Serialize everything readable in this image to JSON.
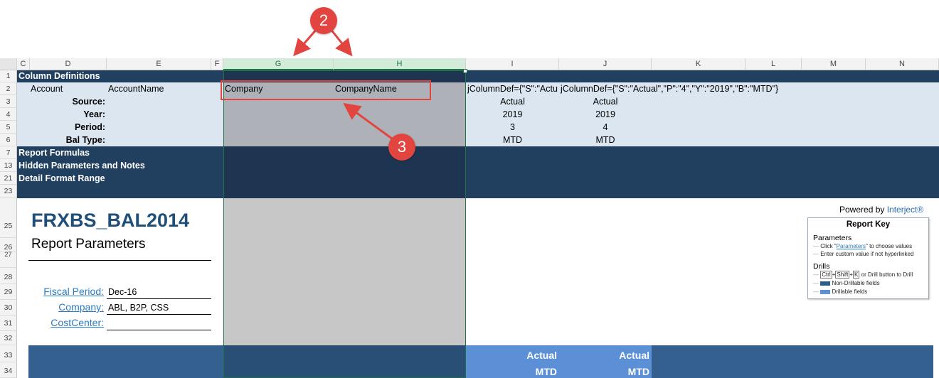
{
  "columns": [
    "C",
    "D",
    "E",
    "F",
    "G",
    "H",
    "I",
    "J",
    "K",
    "L",
    "M",
    "N"
  ],
  "rows": [
    "1",
    "2",
    "3",
    "4",
    "5",
    "6",
    "7",
    "13",
    "21",
    "23",
    "25",
    "26",
    "27",
    "28",
    "29",
    "30",
    "31",
    "32",
    "33",
    "34"
  ],
  "sections": {
    "column_definitions": "Column Definitions",
    "report_formulas": "Report Formulas",
    "hidden_params": "Hidden Parameters and Notes",
    "detail_format": "Detail Format Range"
  },
  "row2": {
    "account": "Account",
    "account_name": "AccountName",
    "company": "Company",
    "company_name": "CompanyName",
    "i_def": "jColumnDef={\"S\":\"Actu",
    "j_def": "jColumnDef={\"S\":\"Actual\",\"P\":\"4\",\"Y\":\"2019\",\"B\":\"MTD\"}"
  },
  "labels": {
    "source": "Source:",
    "year": "Year:",
    "period": "Period:",
    "bal_type": "Bal Type:"
  },
  "col_i": {
    "source": "Actual",
    "year": "2019",
    "period": "3",
    "bal_type": "MTD"
  },
  "col_j": {
    "source": "Actual",
    "year": "2019",
    "period": "4",
    "bal_type": "MTD"
  },
  "report": {
    "title": "FRXBS_BAL2014",
    "subtitle": "Report Parameters",
    "fiscal_label": "Fiscal Period:",
    "fiscal_value": "Dec-16",
    "company_label": "Company:",
    "company_value": "ABL, B2P, CSS",
    "cost_label": "CostCenter:",
    "cost_value": ""
  },
  "powered": {
    "prefix": "Powered by ",
    "brand": "Interject",
    "mark": "®"
  },
  "report_key": {
    "title": "Report Key",
    "params_heading": "Parameters",
    "line1_pre": "Click \"",
    "line1_link": "Parameters",
    "line1_post": "\" to choose values",
    "line2": "Enter custom value if not hyperlinked",
    "drills_heading": "Drills",
    "key_ctrl": "Ctrl",
    "key_shift": "Shift",
    "key_k": "K",
    "drill_line_post": "or Drill button to Drill",
    "non_drillable": "Non-Drillable fields",
    "drillable": "Drillable fields"
  },
  "bottom": {
    "i_actual": "Actual",
    "j_actual": "Actual",
    "i_mtd": "MTD",
    "j_mtd": "MTD"
  },
  "markers": {
    "two": "2",
    "three": "3"
  },
  "colors": {
    "dark_navy": "#21405f",
    "light_blue": "#dce6f1",
    "gray_fill": "#aeb2b8",
    "hidden_gray": "#c7c7c7",
    "bottom_blue": "#34608f",
    "bright_blue": "#5b8fd6",
    "red": "#e2453f"
  }
}
